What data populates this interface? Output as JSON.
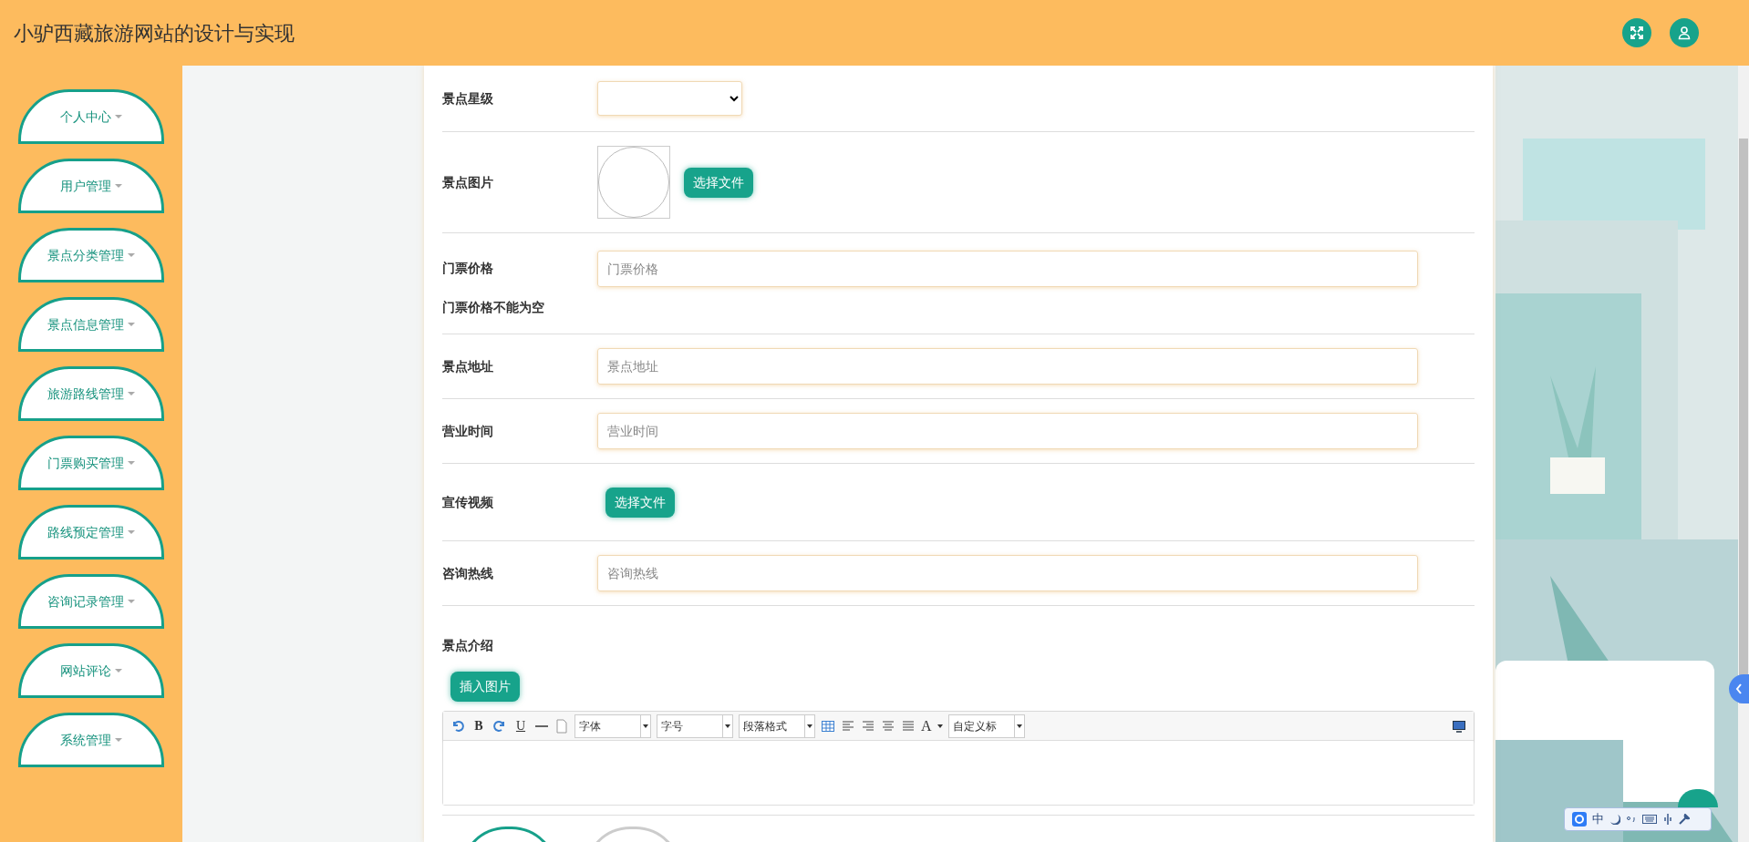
{
  "header": {
    "title": "小驴西藏旅游网站的设计与实现"
  },
  "sidebar": {
    "items": [
      {
        "label": "个人中心"
      },
      {
        "label": "用户管理"
      },
      {
        "label": "景点分类管理"
      },
      {
        "label": "景点信息管理"
      },
      {
        "label": "旅游路线管理"
      },
      {
        "label": "门票购买管理"
      },
      {
        "label": "路线预定管理"
      },
      {
        "label": "咨询记录管理"
      },
      {
        "label": "网站评论"
      },
      {
        "label": "系统管理"
      }
    ]
  },
  "form": {
    "fields": [
      {
        "kind": "select",
        "label": "景点星级"
      },
      {
        "label": "景点图片",
        "button": "选择文件"
      },
      {
        "kind": "text",
        "label": "门票价格",
        "placeholder": "门票价格",
        "error": "门票价格不能为空"
      },
      {
        "kind": "text",
        "label": "景点地址",
        "placeholder": "景点地址"
      },
      {
        "kind": "text",
        "label": "营业时间",
        "placeholder": "营业时间"
      },
      {
        "kind": "file",
        "label": "宣传视频",
        "button": "选择文件"
      },
      {
        "kind": "text",
        "label": "咨询热线",
        "placeholder": "咨询热线"
      },
      {
        "kind": "editor",
        "label": "景点介绍",
        "button": "插入图片",
        "toolbar": [
          {
            "kind": "undo"
          },
          {
            "kind": "bold",
            "label": "B"
          },
          {
            "kind": "redo"
          },
          {
            "kind": "underline",
            "label": "U"
          },
          {
            "kind": "rule"
          },
          {
            "kind": "page"
          },
          {
            "kind": "dropdown",
            "label": "字体"
          },
          {
            "kind": "dropdown",
            "label": "字号"
          },
          {
            "kind": "dropdown",
            "label": "段落格式"
          },
          {
            "kind": "table"
          },
          {
            "kind": "align-left"
          },
          {
            "kind": "align-right"
          },
          {
            "kind": "align-center"
          },
          {
            "kind": "justify"
          },
          {
            "kind": "color",
            "label": "A"
          },
          {
            "kind": "dropdown",
            "label": "自定义标"
          },
          {
            "kind": "preview"
          }
        ]
      }
    ],
    "actions": [
      {
        "kind": "primary"
      },
      {
        "kind": "secondary"
      }
    ]
  },
  "ime": {
    "mode": "中"
  }
}
